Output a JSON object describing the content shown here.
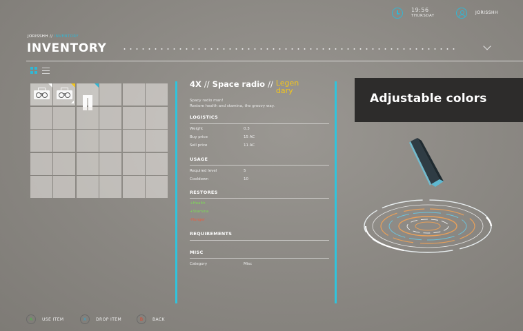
{
  "header": {
    "time": "19:56",
    "day": "THURSDAY",
    "username": "JORISSHH",
    "clock_icon": "clock-icon",
    "user_icon": "user-icon"
  },
  "breadcrumb": {
    "root": "JORISSHH",
    "separator": " // ",
    "current": "INVENTORY"
  },
  "page": {
    "title": "INVENTORY"
  },
  "view_toggle": {
    "grid_icon": "grid-view-icon",
    "list_icon": "list-view-icon",
    "active": "grid"
  },
  "inventory": {
    "columns": 6,
    "rows": 5,
    "items": [
      {
        "slot": 0,
        "icon": "radio-icon",
        "corner_color": "#ffffff"
      },
      {
        "slot": 1,
        "icon": "radio-icon",
        "corner_color": "#f2c51c",
        "stacked": true
      },
      {
        "slot": 2,
        "icon": "pants-icon",
        "corner_color": "#2fb8d6"
      }
    ]
  },
  "item": {
    "quantity": "4X",
    "sep": "//",
    "name": "Space radio",
    "rarity": "Legen dary",
    "desc_line1": "Spacy radio man!",
    "desc_line2": "Restore health and stamina, the groovy way.",
    "sections": {
      "logistics": {
        "title": "LOGISTICS",
        "rows": [
          {
            "label": "Weight",
            "value": "0.3"
          },
          {
            "label": "Buy price",
            "value": "15 AC"
          },
          {
            "label": "Sell price",
            "value": "11 AC"
          }
        ]
      },
      "usage": {
        "title": "USAGE",
        "rows": [
          {
            "label": "Required level",
            "value": "5"
          },
          {
            "label": "Cooldown",
            "value": "10"
          }
        ]
      },
      "restores": {
        "title": "RESTORES",
        "lines": [
          {
            "text": "+Health",
            "color": "#7ed957"
          },
          {
            "text": "+Stamina",
            "color": "#7ed957"
          },
          {
            "text": "-Hunger",
            "color": "#ef5a3c"
          }
        ]
      },
      "requirements": {
        "title": "REQUIREMENTS"
      },
      "misc": {
        "title": "MISC",
        "rows": [
          {
            "label": "Category",
            "value": "Misc"
          }
        ]
      }
    }
  },
  "promo": {
    "text": "Adjustable colors"
  },
  "footer": {
    "buttons": [
      {
        "key": "A",
        "label": "USE ITEM",
        "color": "#4db848"
      },
      {
        "key": "X",
        "label": "DROP ITEM",
        "color": "#2fa8d6"
      },
      {
        "key": "B",
        "label": "BACK",
        "color": "#e0452b"
      }
    ]
  },
  "colors": {
    "accent": "#2fb8d6",
    "legendary": "#f2c51c",
    "background": "#8d8a85"
  }
}
